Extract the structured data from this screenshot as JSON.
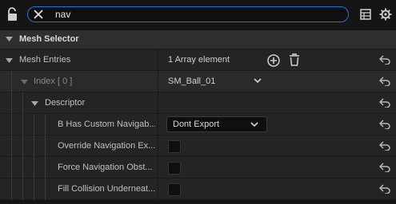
{
  "search": {
    "value": "nav"
  },
  "section": {
    "title": "Mesh Selector"
  },
  "rows": {
    "mesh_entries": {
      "label": "Mesh Entries",
      "value": "1 Array element"
    },
    "index": {
      "label": "Index [ 0 ]",
      "value": "SM_Ball_01"
    },
    "descriptor": {
      "label": "Descriptor"
    },
    "has_custom_nav": {
      "label": "B Has Custom Navigab...",
      "value": "Dont Export"
    },
    "override_nav": {
      "label": "Override Navigation Ex..."
    },
    "force_nav": {
      "label": "Force Navigation Obst..."
    },
    "fill_collision": {
      "label": "Fill Collision Underneat..."
    }
  },
  "icons": {
    "lock": "unlock-icon",
    "clear": "close-icon",
    "table": "table-view-icon",
    "settings": "gear-icon",
    "add": "add-circle-icon",
    "delete": "trash-icon",
    "reset": "reset-to-default-icon",
    "chevron": "chevron-down-icon"
  },
  "colors": {
    "accent": "#2a6fd6",
    "background": "#151515",
    "row": "#242424",
    "section": "#2f2f2f"
  }
}
